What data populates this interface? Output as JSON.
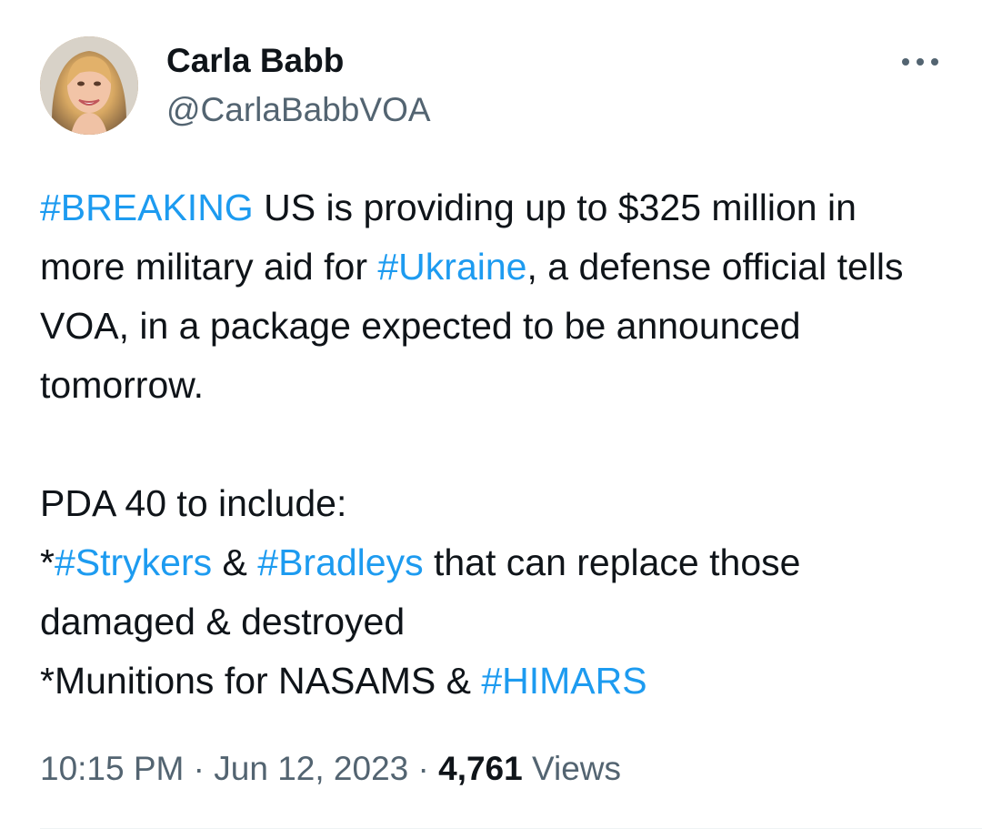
{
  "author": {
    "name": "Carla Babb",
    "handle": "@CarlaBabbVOA"
  },
  "tweet": {
    "line1_hashtag": "#BREAKING",
    "line1_text": " US is providing up to $325 million in more military aid for ",
    "line2_hashtag": "#Ukraine",
    "line2_text": ", a defense official tells VOA, in a package expected to be announced tomorrow.\n\nPDA 40 to include:\n*",
    "strykers_hashtag": "#Strykers",
    "amp1": " & ",
    "bradleys_hashtag": "#Bradleys",
    "bradleys_text": " that can replace those damaged & destroyed\n*Munitions for NASAMS & ",
    "himars_hashtag": "#HIMARS"
  },
  "meta": {
    "time": "10:15 PM",
    "separator": " · ",
    "date": "Jun 12, 2023",
    "views_count": "4,761",
    "views_label": " Views"
  },
  "icons": {
    "more": "more-horizontal-icon",
    "avatar": "profile-photo"
  },
  "colors": {
    "hashtag": "#1d9bf0",
    "text": "#0f1419",
    "secondary": "#536471"
  }
}
